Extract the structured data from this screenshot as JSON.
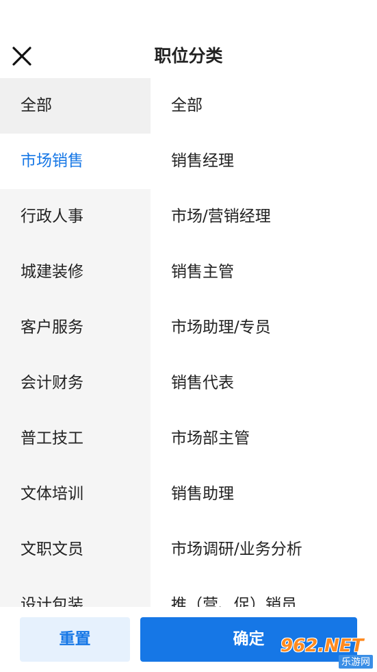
{
  "header": {
    "title": "职位分类",
    "close_icon": "close-icon"
  },
  "categories": [
    {
      "label": "全部"
    },
    {
      "label": "市场销售"
    },
    {
      "label": "行政人事"
    },
    {
      "label": "城建装修"
    },
    {
      "label": "客户服务"
    },
    {
      "label": "会计财务"
    },
    {
      "label": "普工技工"
    },
    {
      "label": "文体培训"
    },
    {
      "label": "文职文员"
    },
    {
      "label": "设计包装"
    }
  ],
  "positions": [
    {
      "label": "全部"
    },
    {
      "label": "销售经理"
    },
    {
      "label": "市场/营销经理"
    },
    {
      "label": "销售主管"
    },
    {
      "label": "市场助理/专员"
    },
    {
      "label": "销售代表"
    },
    {
      "label": "市场部主管"
    },
    {
      "label": "销售助理"
    },
    {
      "label": "市场调研/业务分析"
    },
    {
      "label": "推（营、促）销员"
    }
  ],
  "footer": {
    "reset_label": "重置",
    "confirm_label": "确定"
  },
  "watermark": {
    "main": "962.NET",
    "sub": "乐游网"
  },
  "colors": {
    "accent": "#1677e6",
    "accent_light": "#e6f1fd",
    "sidebar_bg": "#f5f5f5"
  }
}
